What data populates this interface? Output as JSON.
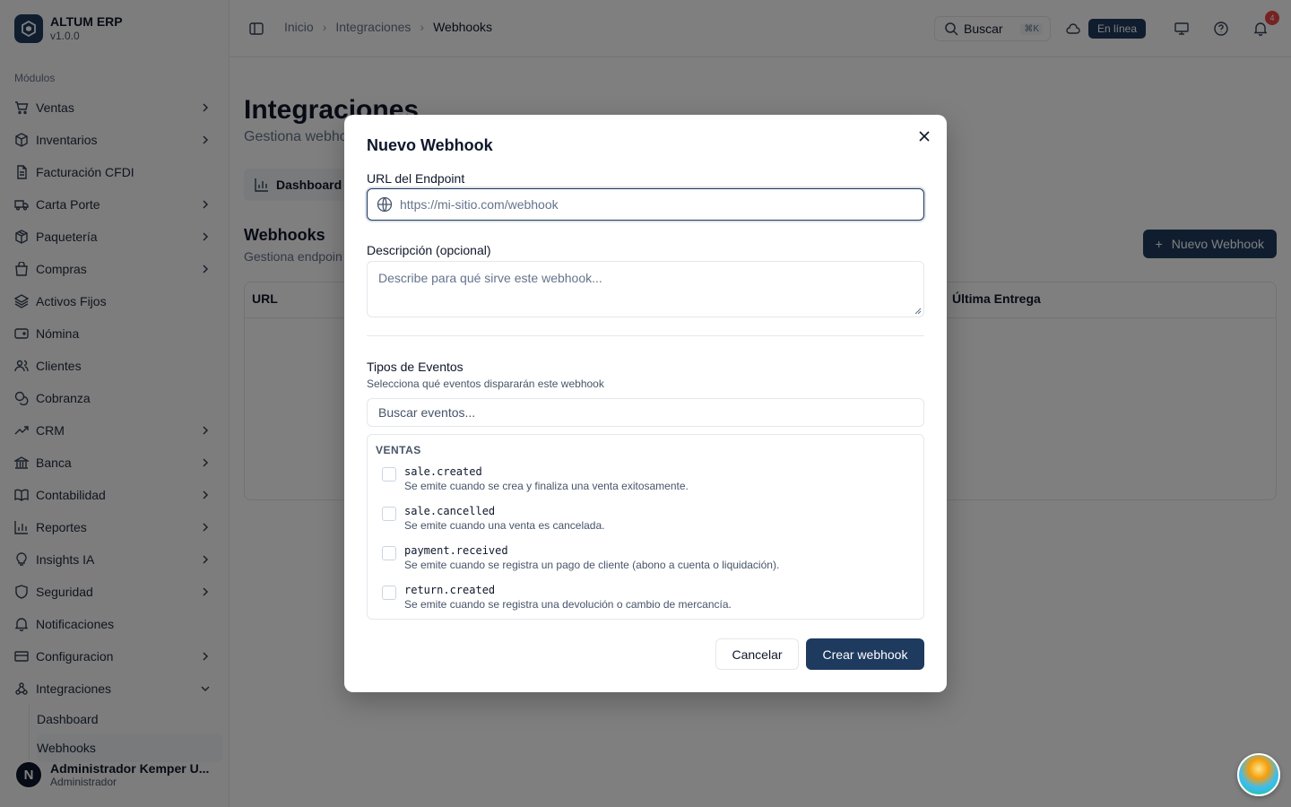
{
  "brand": {
    "name": "ALTUM ERP",
    "version": "v1.0.0"
  },
  "sidebar": {
    "modules_label": "Módulos",
    "items": [
      {
        "label": "Ventas",
        "icon": "cart-icon",
        "chevron": true
      },
      {
        "label": "Inventarios",
        "icon": "box-icon",
        "chevron": true
      },
      {
        "label": "Facturación CFDI",
        "icon": "file-icon",
        "chevron": false
      },
      {
        "label": "Carta Porte",
        "icon": "truck-icon",
        "chevron": true
      },
      {
        "label": "Paquetería",
        "icon": "package-icon",
        "chevron": true
      },
      {
        "label": "Compras",
        "icon": "bag-icon",
        "chevron": true
      },
      {
        "label": "Activos Fijos",
        "icon": "layers-icon",
        "chevron": false
      },
      {
        "label": "Nómina",
        "icon": "wallet-icon",
        "chevron": false
      },
      {
        "label": "Clientes",
        "icon": "users-icon",
        "chevron": false
      },
      {
        "label": "Cobranza",
        "icon": "coins-icon",
        "chevron": false
      },
      {
        "label": "CRM",
        "icon": "trend-icon",
        "chevron": true
      },
      {
        "label": "Banca",
        "icon": "bank-icon",
        "chevron": true
      },
      {
        "label": "Contabilidad",
        "icon": "book-icon",
        "chevron": true
      },
      {
        "label": "Reportes",
        "icon": "bar-chart-icon",
        "chevron": true
      },
      {
        "label": "Insights IA",
        "icon": "bulb-icon",
        "chevron": true
      },
      {
        "label": "Seguridad",
        "icon": "shield-icon",
        "chevron": true
      },
      {
        "label": "Notificaciones",
        "icon": "bell-icon",
        "chevron": false
      },
      {
        "label": "Configuracion",
        "icon": "settings-icon",
        "chevron": true
      },
      {
        "label": "Integraciones",
        "icon": "webhook-icon",
        "chevron": true,
        "expanded": true
      }
    ],
    "sub_items": [
      "Dashboard",
      "Webhooks"
    ]
  },
  "user": {
    "initial": "N",
    "name": "Administrador Kemper U...",
    "role": "Administrador"
  },
  "header": {
    "breadcrumbs": [
      "Inicio",
      "Integraciones",
      "Webhooks"
    ],
    "search_label": "Buscar",
    "search_kbd": "⌘K",
    "status": "En línea",
    "notification_count": "4"
  },
  "page": {
    "title": "Integraciones",
    "subtitle": "Gestiona webho",
    "tab": "Dashboard",
    "section_title": "Webhooks",
    "section_sub": "Gestiona endpoin",
    "new_button": "Nuevo Webhook",
    "table_headers": [
      "URL",
      "Última Entrega"
    ]
  },
  "modal": {
    "title": "Nuevo Webhook",
    "url_label": "URL del Endpoint",
    "url_placeholder": "https://mi-sitio.com/webhook",
    "desc_label": "Descripción (opcional)",
    "desc_placeholder": "Describe para qué sirve este webhook...",
    "events_title": "Tipos de Eventos",
    "events_sub": "Selecciona qué eventos dispararán este webhook",
    "events_search_placeholder": "Buscar eventos...",
    "group": "VENTAS",
    "events": [
      {
        "code": "sale.created",
        "desc": "Se emite cuando se crea y finaliza una venta exitosamente.",
        "checked": false
      },
      {
        "code": "sale.cancelled",
        "desc": "Se emite cuando una venta es cancelada.",
        "checked": false
      },
      {
        "code": "payment.received",
        "desc": "Se emite cuando se registra un pago de cliente (abono a cuenta o liquidación).",
        "checked": false
      },
      {
        "code": "return.created",
        "desc": "Se emite cuando se registra una devolución o cambio de mercancía.",
        "checked": false
      }
    ],
    "cancel": "Cancelar",
    "create": "Crear webhook"
  },
  "colors": {
    "accent": "#1e3a5f",
    "badge": "#ef4444"
  }
}
